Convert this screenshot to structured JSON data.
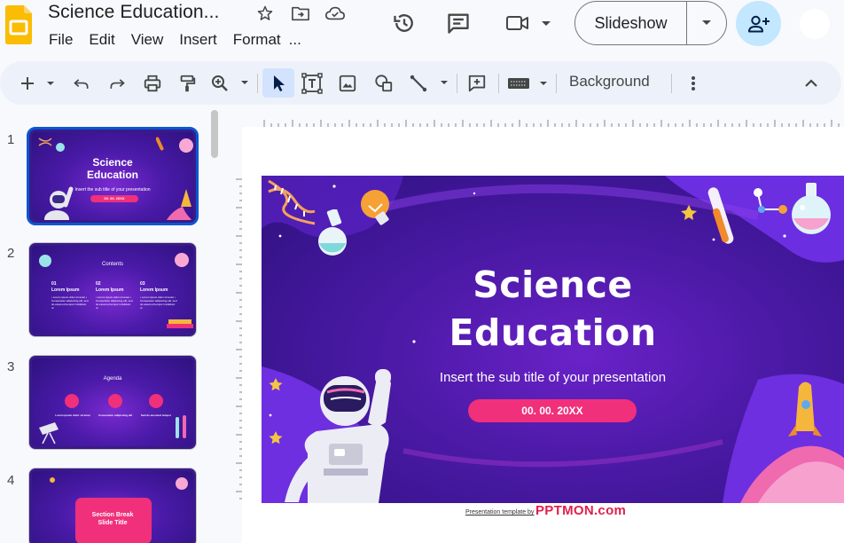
{
  "app": {
    "icon": "google-slides-icon",
    "brand_color": "#fbbc04"
  },
  "document": {
    "title": "Science Education..."
  },
  "menu": [
    "File",
    "Edit",
    "View",
    "Insert",
    "Format",
    "..."
  ],
  "header": {
    "slideshow_label": "Slideshow",
    "share_icon": "add-person-icon"
  },
  "toolbar": {
    "background_label": "Background"
  },
  "filmstrip": {
    "slides": [
      {
        "number": "1",
        "title_line1": "Science",
        "title_line2": "Education",
        "subtitle": "Insert the sub title of your presentation",
        "date": "00. 00. 20XX"
      },
      {
        "number": "2",
        "title": "Contents",
        "col_numbers": [
          "01",
          "02",
          "03"
        ],
        "col_heading": "Lorem Ipsum",
        "col_text": "• Lorem ipsum dolor sit amet • Consectetur adipiscing elit, sed do eiusmod tempor incididunt ut"
      },
      {
        "number": "3",
        "title": "Agenda",
        "items": [
          "Lorem ipsum dolor sit amet",
          "Consectetur adipiscing elit",
          "Sed do eiusmod tempor"
        ]
      },
      {
        "number": "4",
        "title_line1": "Section Break",
        "title_line2": "Slide Title"
      }
    ]
  },
  "slide": {
    "title_line1": "Science",
    "title_line2": "Education",
    "subtitle": "Insert the sub title of your presentation",
    "date": "00. 00. 20XX",
    "accent_color": "#f0307a",
    "background_color": "#4d1aa8"
  },
  "credit": {
    "text": "Presentation template by",
    "brand": "PPTMON.com"
  }
}
